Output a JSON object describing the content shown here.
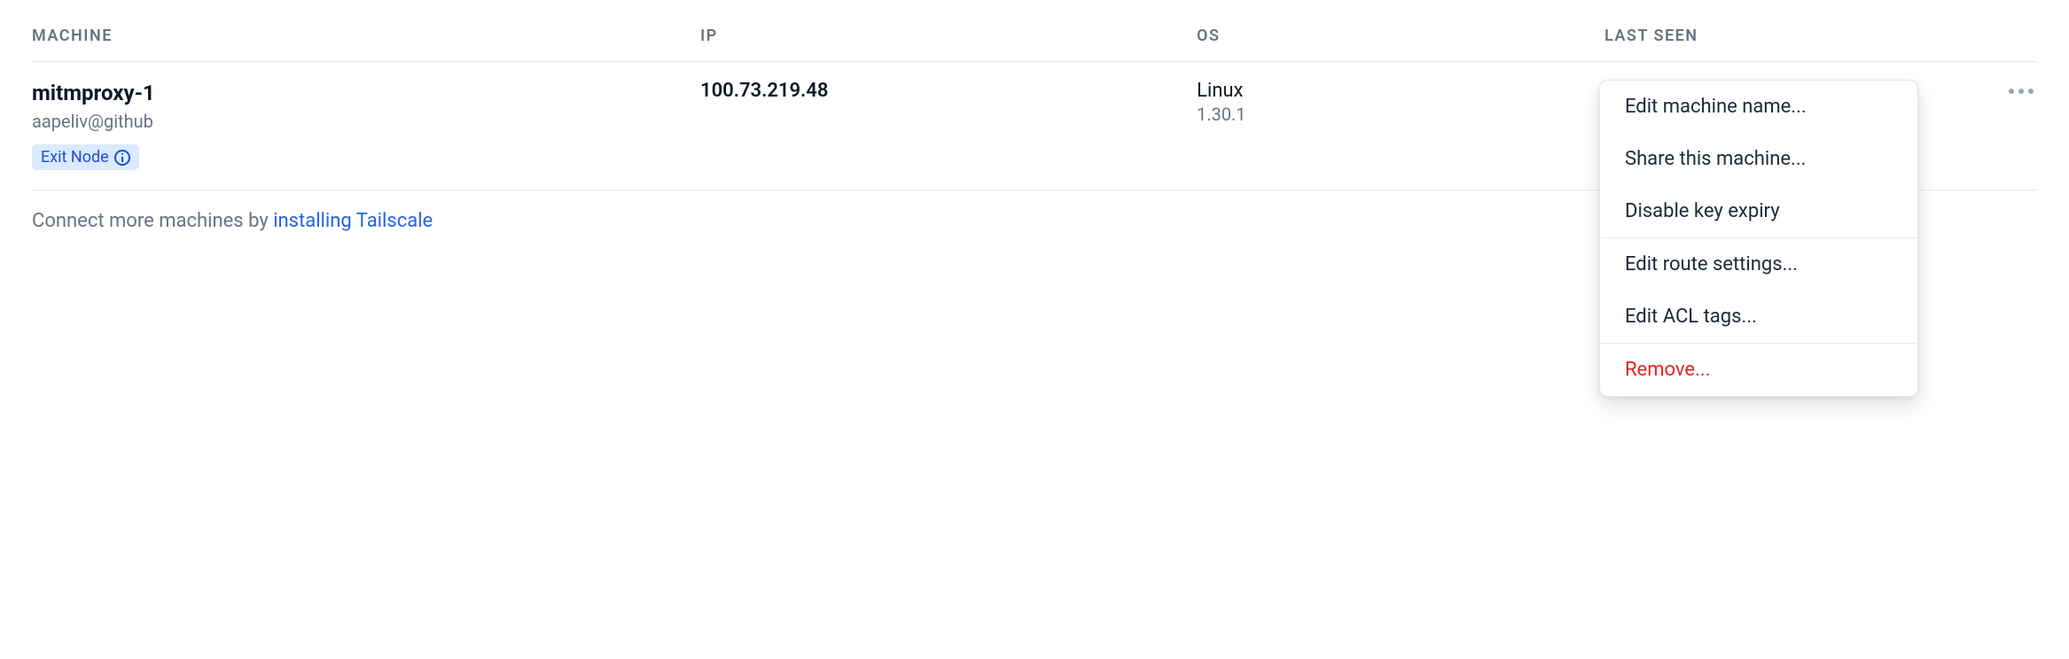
{
  "headers": {
    "machine": "MACHINE",
    "ip": "IP",
    "os": "OS",
    "last_seen": "LAST SEEN"
  },
  "row": {
    "name": "mitmproxy-1",
    "user": "aapeliv@github",
    "badge_label": "Exit Node",
    "ip": "100.73.219.48",
    "os_name": "Linux",
    "os_version": "1.30.1"
  },
  "menu": {
    "edit_name": "Edit machine name...",
    "share": "Share this machine...",
    "disable_expiry": "Disable key expiry",
    "edit_routes": "Edit route settings...",
    "edit_acl": "Edit ACL tags...",
    "remove": "Remove..."
  },
  "footer": {
    "prefix": "Connect more machines by ",
    "link": "installing Tailscale"
  }
}
